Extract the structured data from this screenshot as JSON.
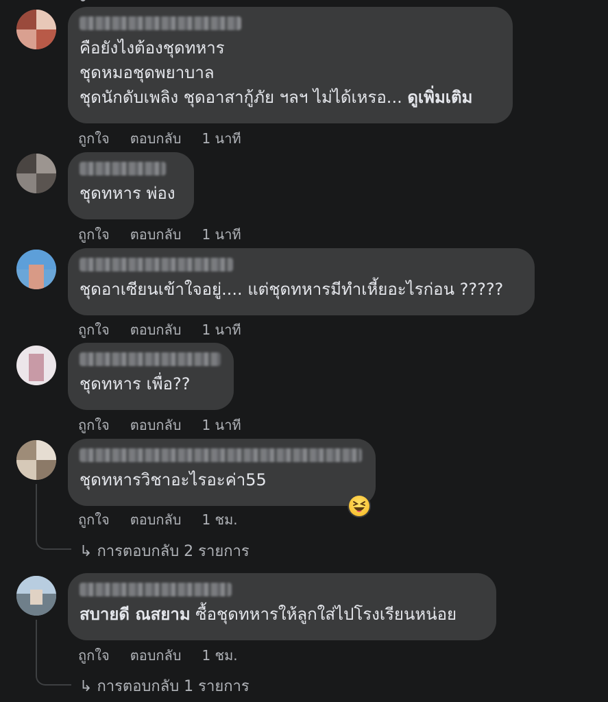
{
  "comments": [
    {
      "lines": [
        "คือยังไงต้องชุดทหาร",
        "ชุดหมอชุดพยาบาล",
        "ชุดนักดับเพลิง ชุดอาสากู้ภัย ฯลฯ ไม่ได้เหรอ..."
      ],
      "see_more": "ดูเพิ่มเติม",
      "like": "ถูกใจ",
      "reply": "ตอบกลับ",
      "time": "1 นาที"
    },
    {
      "lines": [
        "ชุดทหาร พ่อง"
      ],
      "like": "ถูกใจ",
      "reply": "ตอบกลับ",
      "time": "1 นาที"
    },
    {
      "lines": [
        "ชุดอาเซียนเข้าใจอยู่.... แต่ชุดทหารมีทำเหี้ยอะไรก่อน ?????"
      ],
      "like": "ถูกใจ",
      "reply": "ตอบกลับ",
      "time": "1 นาที"
    },
    {
      "lines": [
        "ชุดทหาร เพื่อ??"
      ],
      "like": "ถูกใจ",
      "reply": "ตอบกลับ",
      "time": "1 นาที"
    },
    {
      "lines": [
        "ชุดทหารวิชาอะไรอะค่า55"
      ],
      "like": "ถูกใจ",
      "reply": "ตอบกลับ",
      "time": "1 ชม.",
      "reaction_icon": "laughing-squint-emoji-icon",
      "replies": "การตอบกลับ 2 รายการ"
    },
    {
      "mention": "สบายดี ณสยาม",
      "text": "ซื้อชุดทหารให้ลูกใส่ไปโรงเรียนหน่อย",
      "like": "ถูกใจ",
      "reply": "ตอบกลับ",
      "time": "1 ชม.",
      "replies": "การตอบกลับ 1 รายการ"
    }
  ],
  "icons": {
    "reply_arrow": "reply-arrow-icon"
  },
  "colors": {
    "background": "#18191a",
    "bubble": "#3a3b3c",
    "text": "#e4e6eb",
    "secondary": "#b0b3b8"
  }
}
